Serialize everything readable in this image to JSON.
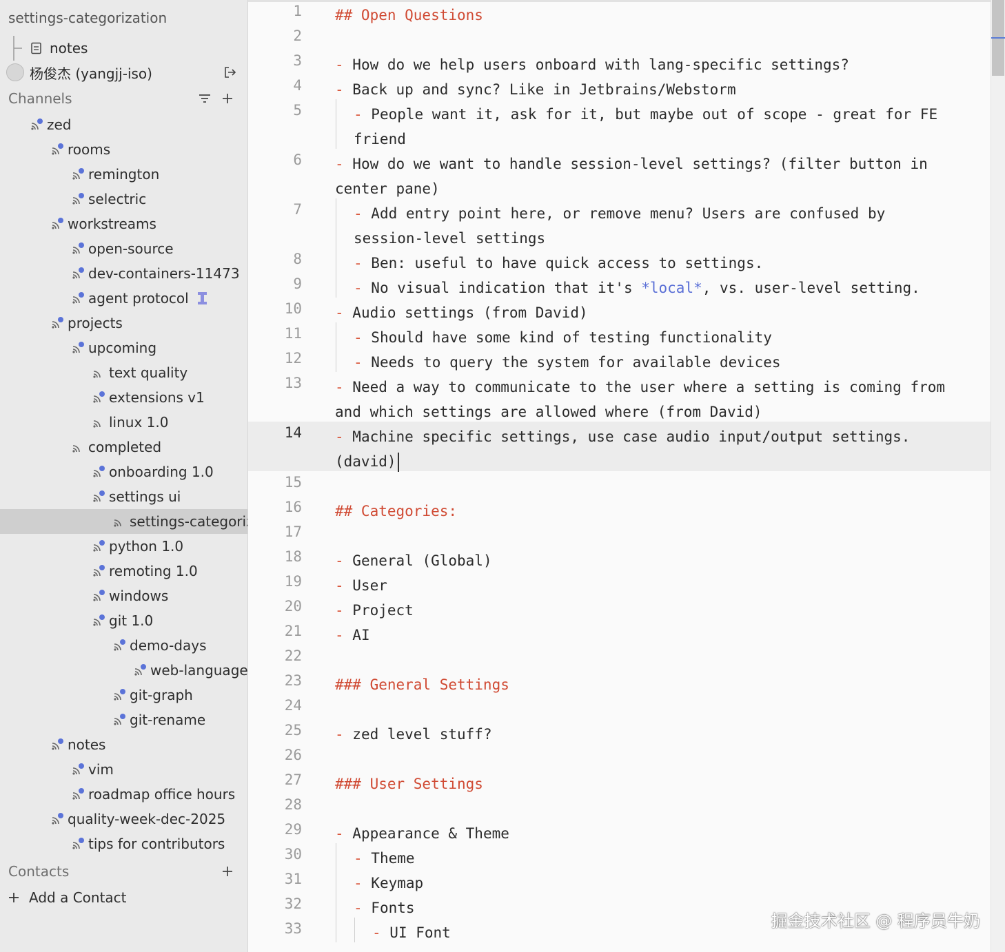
{
  "sidebar": {
    "title": "settings-categorization",
    "notes_label": "notes",
    "user_name": "杨俊杰 (yangjj-iso)",
    "channels_header": "Channels",
    "contacts_header": "Contacts",
    "add_contact_label": "Add a Contact",
    "channels": [
      {
        "label": "zed",
        "depth": 0,
        "dot": true
      },
      {
        "label": "rooms",
        "depth": 1,
        "dot": true
      },
      {
        "label": "remington",
        "depth": 2,
        "dot": true
      },
      {
        "label": "selectric",
        "depth": 2,
        "dot": true
      },
      {
        "label": "workstreams",
        "depth": 1,
        "dot": true
      },
      {
        "label": "open-source",
        "depth": 2,
        "dot": true
      },
      {
        "label": "dev-containers-11473",
        "depth": 2,
        "dot": true
      },
      {
        "label": "agent protocol",
        "depth": 2,
        "dot": true,
        "badge": true
      },
      {
        "label": "projects",
        "depth": 1,
        "dot": true
      },
      {
        "label": "upcoming",
        "depth": 2,
        "dot": true
      },
      {
        "label": "text quality",
        "depth": 3,
        "dot": false
      },
      {
        "label": "extensions v1",
        "depth": 3,
        "dot": true
      },
      {
        "label": "linux 1.0",
        "depth": 3,
        "dot": false
      },
      {
        "label": "completed",
        "depth": 2,
        "dot": false
      },
      {
        "label": "onboarding 1.0",
        "depth": 3,
        "dot": true
      },
      {
        "label": "settings ui",
        "depth": 3,
        "dot": true
      },
      {
        "label": "settings-categorization",
        "depth": 4,
        "dot": false,
        "selected": true
      },
      {
        "label": "python 1.0",
        "depth": 3,
        "dot": true
      },
      {
        "label": "remoting 1.0",
        "depth": 3,
        "dot": true
      },
      {
        "label": "windows",
        "depth": 3,
        "dot": true
      },
      {
        "label": "git 1.0",
        "depth": 3,
        "dot": true
      },
      {
        "label": "demo-days",
        "depth": 4,
        "dot": true
      },
      {
        "label": "web-languages",
        "depth": 5,
        "dot": true
      },
      {
        "label": "git-graph",
        "depth": 4,
        "dot": true
      },
      {
        "label": "git-rename",
        "depth": 4,
        "dot": true
      },
      {
        "label": "notes",
        "depth": 1,
        "dot": true
      },
      {
        "label": "vim",
        "depth": 2,
        "dot": true
      },
      {
        "label": "roadmap office hours",
        "depth": 2,
        "dot": true
      },
      {
        "label": "quality-week-dec-2025",
        "depth": 1,
        "dot": true
      },
      {
        "label": "tips for contributors",
        "depth": 2,
        "dot": true
      }
    ]
  },
  "editor": {
    "active_line": 14,
    "lines": [
      {
        "n": "1",
        "segs": [
          [
            "h",
            "## Open Questions"
          ]
        ]
      },
      {
        "n": "2",
        "segs": []
      },
      {
        "n": "3",
        "segs": [
          [
            "d",
            "- "
          ],
          [
            "t",
            "How do we help users onboard with lang-specific settings?"
          ]
        ]
      },
      {
        "n": "4",
        "segs": [
          [
            "d",
            "- "
          ],
          [
            "t",
            "Back up and sync? Like in Jetbrains/Webstorm"
          ]
        ]
      },
      {
        "n": "5",
        "indent": 1,
        "rows": 2,
        "segs": [
          [
            "d",
            "- "
          ],
          [
            "t",
            "People want it, ask for it, but maybe out of scope - great for FE friend"
          ]
        ]
      },
      {
        "n": "6",
        "rows": 2,
        "segs": [
          [
            "d",
            "- "
          ],
          [
            "t",
            "How do we want to handle session-level settings? (filter button in center pane)"
          ]
        ]
      },
      {
        "n": "7",
        "indent": 1,
        "rows": 2,
        "segs": [
          [
            "d",
            "- "
          ],
          [
            "t",
            "Add entry point here, or remove menu? Users are confused by session-level settings"
          ]
        ]
      },
      {
        "n": "8",
        "indent": 1,
        "segs": [
          [
            "d",
            "- "
          ],
          [
            "t",
            "Ben: useful to have quick access to settings."
          ]
        ]
      },
      {
        "n": "9",
        "indent": 1,
        "segs": [
          [
            "d",
            "- "
          ],
          [
            "t",
            "No visual indication that it's "
          ],
          [
            "e",
            "*local*"
          ],
          [
            "t",
            ", vs. user-level setting."
          ]
        ]
      },
      {
        "n": "10",
        "segs": [
          [
            "d",
            "- "
          ],
          [
            "t",
            "Audio settings (from David)"
          ]
        ]
      },
      {
        "n": "11",
        "indent": 1,
        "segs": [
          [
            "d",
            "- "
          ],
          [
            "t",
            "Should have some kind of testing functionality"
          ]
        ]
      },
      {
        "n": "12",
        "indent": 1,
        "segs": [
          [
            "d",
            "- "
          ],
          [
            "t",
            "Needs to query the system for available devices"
          ]
        ]
      },
      {
        "n": "13",
        "rows": 2,
        "segs": [
          [
            "d",
            "- "
          ],
          [
            "t",
            "Need a way to communicate to the user where a setting is coming from and which settings are allowed where (from David)"
          ]
        ]
      },
      {
        "n": "14",
        "rows": 2,
        "segs": [
          [
            "d",
            "- "
          ],
          [
            "t",
            "Machine specific settings, use case audio input/output settings. (david)"
          ]
        ]
      },
      {
        "n": "15",
        "segs": []
      },
      {
        "n": "16",
        "segs": [
          [
            "h",
            "## Categories:"
          ]
        ]
      },
      {
        "n": "17",
        "segs": []
      },
      {
        "n": "18",
        "segs": [
          [
            "d",
            "- "
          ],
          [
            "t",
            "General (Global)"
          ]
        ]
      },
      {
        "n": "19",
        "segs": [
          [
            "d",
            "- "
          ],
          [
            "t",
            "User"
          ]
        ]
      },
      {
        "n": "20",
        "segs": [
          [
            "d",
            "- "
          ],
          [
            "t",
            "Project"
          ]
        ]
      },
      {
        "n": "21",
        "segs": [
          [
            "d",
            "- "
          ],
          [
            "t",
            "AI"
          ]
        ]
      },
      {
        "n": "22",
        "segs": []
      },
      {
        "n": "23",
        "segs": [
          [
            "h",
            "### General Settings"
          ]
        ]
      },
      {
        "n": "24",
        "segs": []
      },
      {
        "n": "25",
        "segs": [
          [
            "d",
            "- "
          ],
          [
            "t",
            "zed level stuff?"
          ]
        ]
      },
      {
        "n": "26",
        "segs": []
      },
      {
        "n": "27",
        "segs": [
          [
            "h",
            "### User Settings"
          ]
        ]
      },
      {
        "n": "28",
        "segs": []
      },
      {
        "n": "29",
        "segs": [
          [
            "d",
            "- "
          ],
          [
            "t",
            "Appearance & Theme"
          ]
        ]
      },
      {
        "n": "30",
        "indent": 1,
        "segs": [
          [
            "d",
            "- "
          ],
          [
            "t",
            "Theme"
          ]
        ]
      },
      {
        "n": "31",
        "indent": 1,
        "segs": [
          [
            "d",
            "- "
          ],
          [
            "t",
            "Keymap"
          ]
        ]
      },
      {
        "n": "32",
        "indent": 1,
        "segs": [
          [
            "d",
            "- "
          ],
          [
            "t",
            "Fonts"
          ]
        ]
      },
      {
        "n": "33",
        "indent": 2,
        "segs": [
          [
            "d",
            "- "
          ],
          [
            "t",
            "UI Font"
          ]
        ]
      }
    ]
  },
  "watermark": "掘金技术社区 @ 程序员牛奶",
  "colors": {
    "heading": "#d04a33",
    "dash": "#d9573c",
    "emphasis": "#5a6fd6",
    "channel_dot": "#5b73d8",
    "sidebar_bg": "#eaeaea",
    "selected_row": "#cfcfcf",
    "editor_bg": "#fafafa"
  },
  "icons": {
    "channel": "hash-broadcast-icon",
    "notes": "notes-icon",
    "leave": "sign-out-icon",
    "filter": "filter-icon",
    "add": "plus-icon"
  }
}
